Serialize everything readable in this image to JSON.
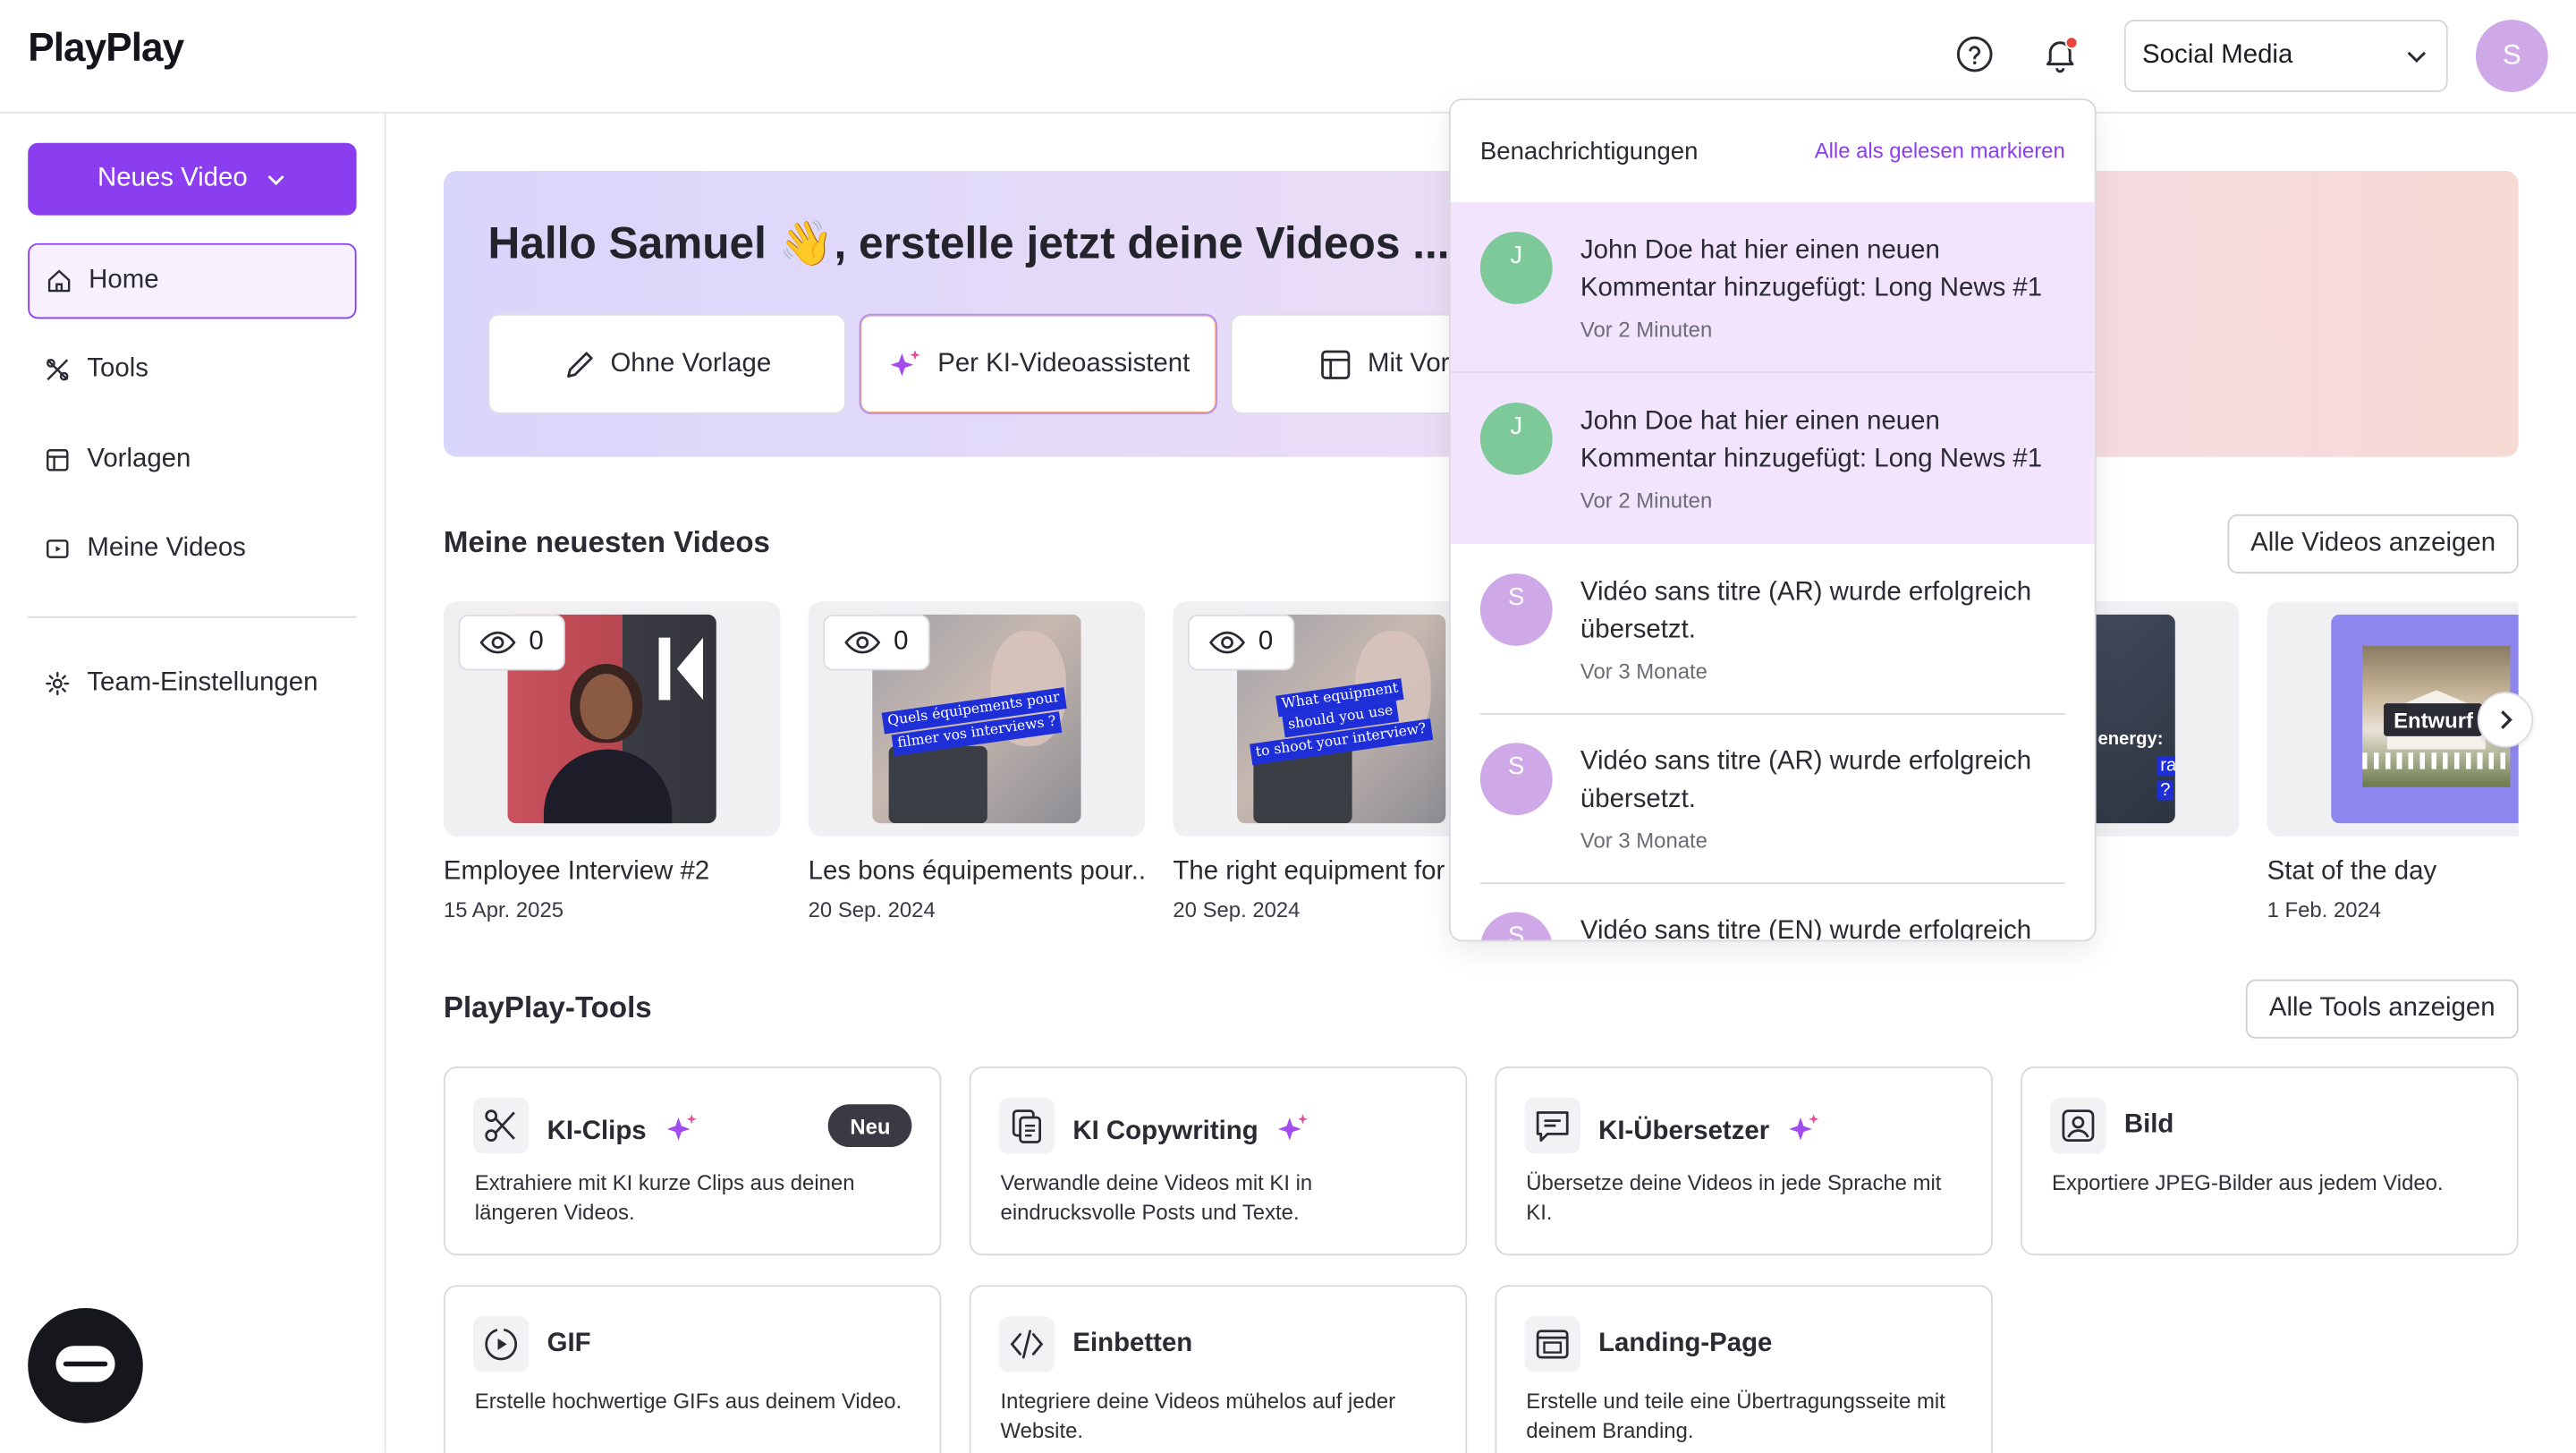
{
  "header": {
    "logo": "PlayPlay",
    "workspace": "Social Media",
    "avatar_initial": "S"
  },
  "sidebar": {
    "new_video": "Neues Video",
    "items": [
      {
        "label": "Home",
        "icon": "home-icon"
      },
      {
        "label": "Tools",
        "icon": "tools-icon"
      },
      {
        "label": "Vorlagen",
        "icon": "template-icon"
      },
      {
        "label": "Meine Videos",
        "icon": "video-icon"
      }
    ],
    "team_settings": "Team-Einstellungen"
  },
  "hero": {
    "title": "Hallo Samuel 👋, erstelle jetzt deine Videos ...",
    "buttons": [
      "Ohne Vorlage",
      "Per KI-Videoassistent",
      "Mit Vorlage"
    ]
  },
  "videos": {
    "section_title": "Meine neuesten Videos",
    "show_all": "Alle Videos anzeigen",
    "items": [
      {
        "views": "0",
        "title": "Employee Interview #2",
        "date": "15 Apr. 2025"
      },
      {
        "views": "0",
        "title": "Les bons équipements pour...",
        "date": "20 Sep. 2024",
        "overlay": [
          "Quels équipements pour",
          "filmer vos interviews ?"
        ]
      },
      {
        "views": "0",
        "title": "The right equipment for t",
        "date": "20 Sep. 2024",
        "overlay": [
          "What equipment",
          "should you use",
          "to shoot your interview?"
        ]
      },
      {
        "title": "Stat of the day",
        "date": "1 Feb. 2024",
        "overlay_label": "Entwurf"
      }
    ],
    "partial_overlay": [
      "energy:",
      "raulic",
      "?"
    ]
  },
  "tools": {
    "section_title": "PlayPlay-Tools",
    "show_all": "Alle Tools anzeigen",
    "items": [
      {
        "name": "KI-Clips",
        "desc": "Extrahiere mit KI kurze Clips aus deinen längeren Videos.",
        "badge": "Neu",
        "ai": true
      },
      {
        "name": "KI Copywriting",
        "desc": "Verwandle deine Videos mit KI in eindrucksvolle Posts und Texte.",
        "ai": true
      },
      {
        "name": "KI-Übersetzer",
        "desc": "Übersetze deine Videos in jede Sprache mit KI.",
        "ai": true
      },
      {
        "name": "Bild",
        "desc": "Exportiere JPEG-Bilder aus jedem Video."
      },
      {
        "name": "GIF",
        "desc": "Erstelle hochwertige GIFs aus deinem Video."
      },
      {
        "name": "Einbetten",
        "desc": "Integriere deine Videos mühelos auf jeder Website."
      },
      {
        "name": "Landing-Page",
        "desc": "Erstelle und teile eine Übertragungsseite mit deinem Branding."
      }
    ]
  },
  "notifications": {
    "title": "Benachrichtigungen",
    "mark_all": "Alle als gelesen markieren",
    "items": [
      {
        "initial": "J",
        "text": "John Doe hat hier einen neuen Kommentar hinzugefügt: Long News #1",
        "time": "Vor 2 Minuten",
        "unread": true
      },
      {
        "initial": "J",
        "text": "John Doe hat hier einen neuen Kommentar hinzugefügt: Long News #1",
        "time": "Vor 2 Minuten",
        "unread": true
      },
      {
        "initial": "S",
        "text": "Vidéo sans titre (AR) wurde erfolgreich übersetzt.",
        "time": "Vor 3 Monate",
        "unread": false
      },
      {
        "initial": "S",
        "text": "Vidéo sans titre (AR) wurde erfolgreich übersetzt.",
        "time": "Vor 3 Monate",
        "unread": false
      },
      {
        "initial": "S",
        "text": "Vidéo sans titre (EN) wurde erfolgreich",
        "time": "",
        "unread": false
      }
    ]
  },
  "colors": {
    "accent": "#8b3df0",
    "avatar_green": "#7dc99a",
    "avatar_purple": "#cfa8e8",
    "unread_bg": "#f1e4fc"
  }
}
